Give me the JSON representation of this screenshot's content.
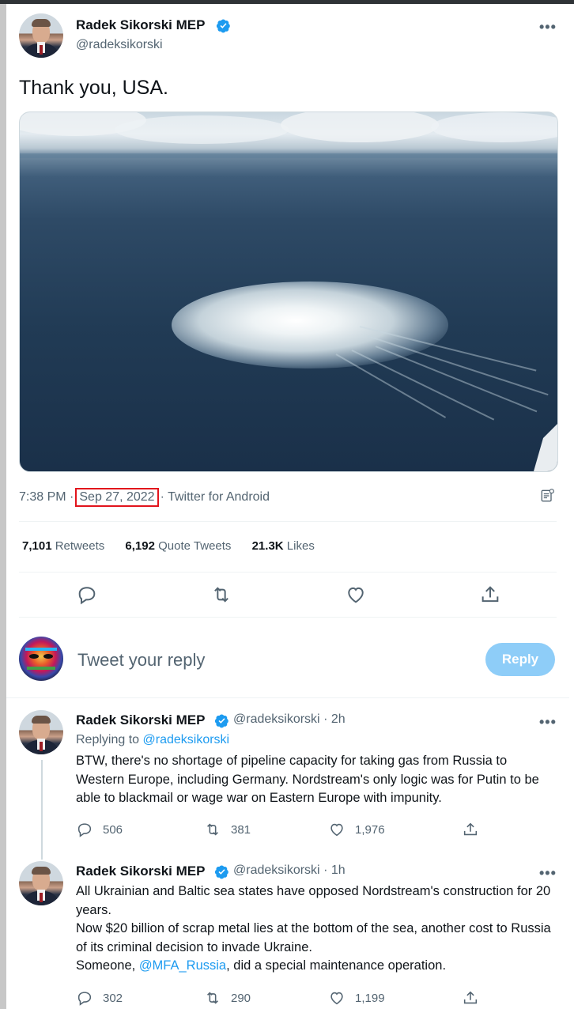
{
  "main_tweet": {
    "author_name": "Radek Sikorski MEP",
    "author_handle": "@radeksikorski",
    "text": "Thank you, USA.",
    "time": "7:38 PM",
    "separator": "·",
    "date": "Sep 27, 2022",
    "source": "Twitter for Android",
    "stats": {
      "retweets_count": "7,101",
      "retweets_label": "Retweets",
      "quotes_count": "6,192",
      "quotes_label": "Quote Tweets",
      "likes_count": "21.3K",
      "likes_label": "Likes"
    },
    "more_label": "•••"
  },
  "composer": {
    "placeholder": "Tweet your reply",
    "button_label": "Reply"
  },
  "replies": [
    {
      "author_name": "Radek Sikorski MEP",
      "author_handle": "@radeksikorski",
      "time_ago": "· 2h",
      "replying_label": "Replying to",
      "replying_handle": "@radeksikorski",
      "text": "BTW, there's no shortage of pipeline capacity for taking gas from Russia to Western Europe, including Germany. Nordstream's only logic was for Putin to be able to blackmail or wage war on Eastern Europe with impunity.",
      "reply_count": "506",
      "retweet_count": "381",
      "like_count": "1,976",
      "more_label": "•••"
    },
    {
      "author_name": "Radek Sikorski MEP",
      "author_handle": "@radeksikorski",
      "time_ago": "· 1h",
      "text_line1": "All Ukrainian and Baltic sea states have opposed Nordstream's construction for 20 years.",
      "text_line2": "Now $20 billion of scrap metal lies at the bottom of the sea, another cost to Russia of its criminal decision to invade Ukraine.",
      "text_line3_prefix": "Someone,",
      "text_line3_mention": "@MFA_Russia",
      "text_line3_suffix": ", did a special maintenance operation.",
      "reply_count": "302",
      "retweet_count": "290",
      "like_count": "1,199",
      "more_label": "•••"
    }
  ],
  "icons": [
    "verified-badge-icon",
    "more-icon",
    "reply-icon",
    "retweet-icon",
    "like-icon",
    "share-icon",
    "analytics-icon"
  ],
  "colors": {
    "accent": "#1d9bf0",
    "reply_button": "#8ecdf8",
    "highlight_box": "#e2141c",
    "secondary_text": "#536471"
  }
}
